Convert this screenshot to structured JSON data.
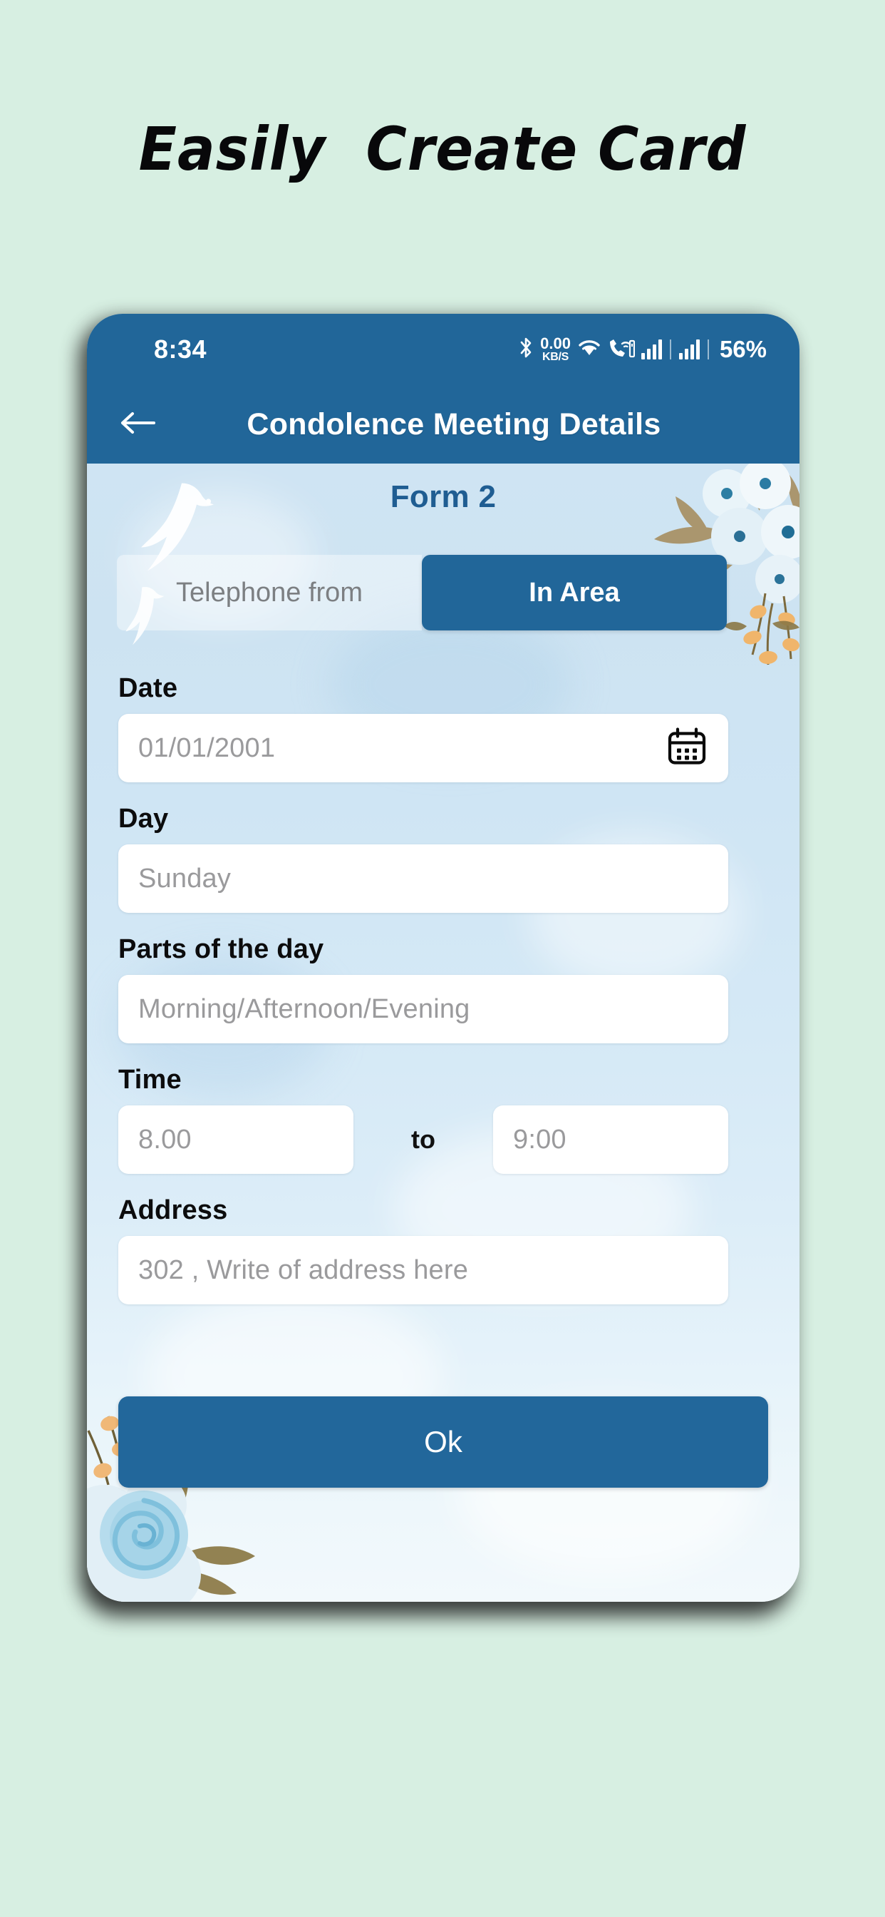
{
  "promo": {
    "heading": "Easily  Create Card"
  },
  "colors": {
    "page_background": "#d7efe2",
    "header_blue": "#216699",
    "accent_blue": "#22679b",
    "form_title_blue": "#1f5d92",
    "card_background": "#cfe4f3",
    "input_background": "#ffffff",
    "placeholder_grey": "#9a9a9c"
  },
  "statusbar": {
    "time": "8:34",
    "network_speed_value": "0.00",
    "network_speed_unit": "KB/S",
    "battery": "56%",
    "icons": [
      "bluetooth-icon",
      "network-speed-indicator",
      "wifi-icon",
      "call-wifi-icon",
      "signal-bars-sim1-icon",
      "signal-bars-sim2-icon"
    ]
  },
  "appbar": {
    "back_icon": "back-arrow-icon",
    "title": "Condolence Meeting Details"
  },
  "form": {
    "title": "Form 2",
    "tabs": [
      {
        "label": "Telephone from",
        "active": false
      },
      {
        "label": "In Area",
        "active": true
      }
    ],
    "fields": [
      {
        "label": "Date",
        "placeholder": "01/01/2001",
        "icon": "calendar-icon"
      },
      {
        "label": "Day",
        "placeholder": "Sunday"
      },
      {
        "label": "Parts of the day",
        "placeholder": "Morning/Afternoon/Evening"
      }
    ],
    "time": {
      "label": "Time",
      "from_placeholder": "8.00",
      "separator": "to",
      "to_placeholder": "9:00"
    },
    "address": {
      "label": "Address",
      "placeholder": "302 , Write of address here"
    },
    "submit_label": "Ok"
  },
  "decorations": {
    "top_right": "watercolor-flowers-decoration",
    "bottom_left": "watercolor-blue-rose-decoration",
    "doves": "flying-dove-graphics"
  }
}
